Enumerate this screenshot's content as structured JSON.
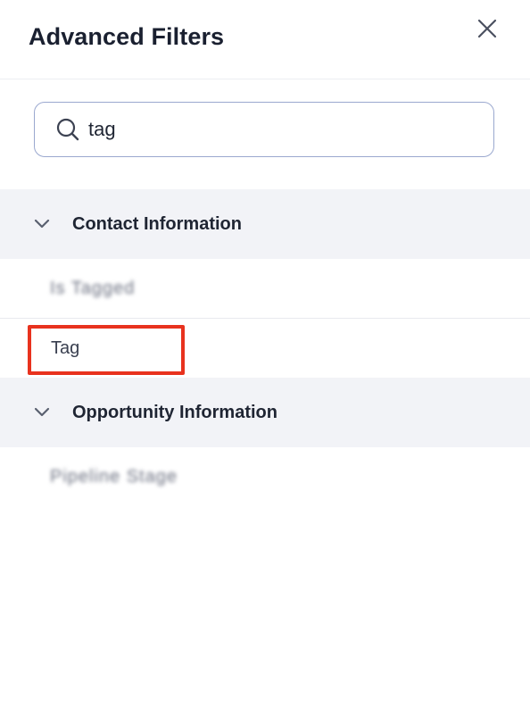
{
  "header": {
    "title": "Advanced Filters",
    "close_icon": "close-icon"
  },
  "search": {
    "value": "tag",
    "icon": "search-icon"
  },
  "sections": [
    {
      "label": "Contact Information",
      "expanded": true,
      "items": [
        {
          "label": "Is Tagged",
          "obscured": true
        },
        {
          "label": "Tag",
          "highlighted": true
        }
      ]
    },
    {
      "label": "Opportunity Information",
      "expanded": true,
      "items": [
        {
          "label": "Pipeline Stage",
          "obscured": true
        }
      ]
    }
  ],
  "colors": {
    "highlight": "#e8321e",
    "section_bg": "#f2f3f7",
    "search_border": "#9aa8cf"
  }
}
